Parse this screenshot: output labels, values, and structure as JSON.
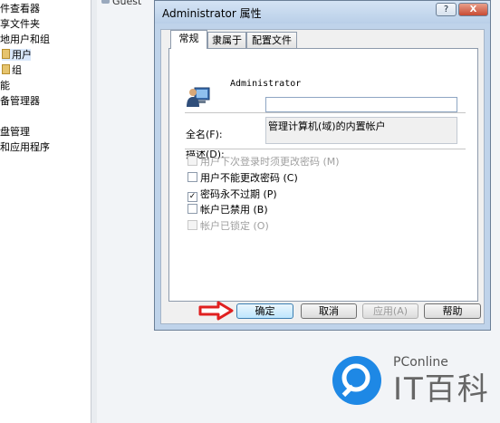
{
  "tree": {
    "items": [
      {
        "label": "件查看器"
      },
      {
        "label": "享文件夹"
      },
      {
        "label": "地用户和组"
      },
      {
        "label": "用户"
      },
      {
        "label": "组"
      },
      {
        "label": "能"
      },
      {
        "label": "备管理器"
      },
      {
        "label": "盘管理"
      },
      {
        "label": "和应用程序"
      }
    ]
  },
  "list": {
    "guest_label": "Guest"
  },
  "dialog": {
    "title": "Administrator 属性",
    "help_glyph": "?",
    "close_glyph": "X",
    "tabs": [
      {
        "label": "常规",
        "active": true
      },
      {
        "label": "隶属于",
        "active": false
      },
      {
        "label": "配置文件",
        "active": false
      }
    ],
    "user_name": "Administrator",
    "fullname_label": "全名(F):",
    "fullname_value": "",
    "description_label": "描述(D):",
    "description_value": "管理计算机(域)的内置帐户",
    "checkboxes": [
      {
        "label": "用户下次登录时须更改密码 (M)",
        "checked": false,
        "enabled": false
      },
      {
        "label": "用户不能更改密码 (C)",
        "checked": false,
        "enabled": true
      },
      {
        "label": "密码永不过期 (P)",
        "checked": true,
        "enabled": true
      },
      {
        "label": "帐户已禁用 (B)",
        "checked": false,
        "enabled": true
      },
      {
        "label": "帐户已锁定 (O)",
        "checked": false,
        "enabled": false
      }
    ],
    "buttons": {
      "ok": "确定",
      "cancel": "取消",
      "apply": "应用(A)",
      "help": "帮助"
    }
  },
  "watermark": {
    "brand_small": "PConline",
    "brand_big": "IT百科"
  },
  "colors": {
    "accent_arrow": "#e02020",
    "watermark_blue": "#1e88e5"
  }
}
